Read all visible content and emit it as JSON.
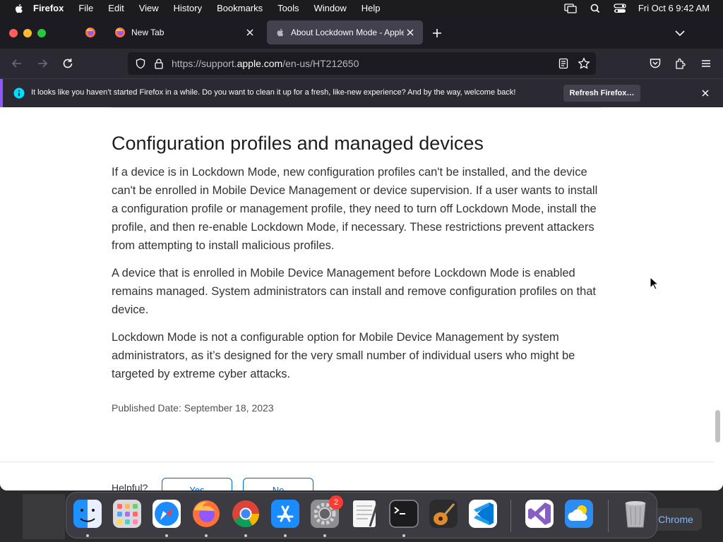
{
  "menubar": {
    "app_name": "Firefox",
    "items": [
      "File",
      "Edit",
      "View",
      "History",
      "Bookmarks",
      "Tools",
      "Window",
      "Help"
    ],
    "clock": "Fri Oct 6  9:42 AM"
  },
  "tabs": {
    "inactive_title": "New Tab",
    "active_title": "About Lockdown Mode - Apple"
  },
  "urlbar": {
    "url_prefix": "https://support.",
    "url_domain": "apple.com",
    "url_path": "/en-us/HT212650"
  },
  "notification": {
    "message": "It looks like you haven’t started Firefox in a while. Do you want to clean it up for a fresh, like-new experience? And by the way, welcome back!",
    "button_label": "Refresh Firefox…"
  },
  "article": {
    "heading": "Configuration profiles and managed devices",
    "paragraphs": [
      "If a device is in Lockdown Mode, new configuration profiles can't be installed, and the device can't be enrolled in Mobile Device Management or device supervision. If a user wants to install a configuration profile or management profile, they need to turn off Lockdown Mode, install the profile, and then re-enable Lockdown Mode, if necessary. These restrictions prevent attackers from attempting to install malicious profiles.",
      "A device that is enrolled in Mobile Device Management before Lockdown Mode is enabled remains managed. System administrators can install and remove configuration profiles on that device.",
      "Lockdown Mode is not a configurable option for Mobile Device Management by system administrators, as it’s designed for the very small number of individual users who might be targeted by extreme cyber attacks."
    ],
    "published": "Published Date: September 18, 2023",
    "helpful_label": "Helpful?",
    "yes_label": "Yes",
    "no_label": "No"
  },
  "dock": {
    "apps": [
      "finder",
      "launchpad",
      "safari",
      "firefox",
      "chrome",
      "app-store",
      "system-settings",
      "textedit",
      "terminal",
      "garageband",
      "vscode",
      "visual-studio",
      "weather",
      "trash"
    ],
    "settings_badge": "2",
    "side_label": "Chrome"
  },
  "colors": {
    "accent": "#9059ff",
    "link": "#0066cc"
  }
}
